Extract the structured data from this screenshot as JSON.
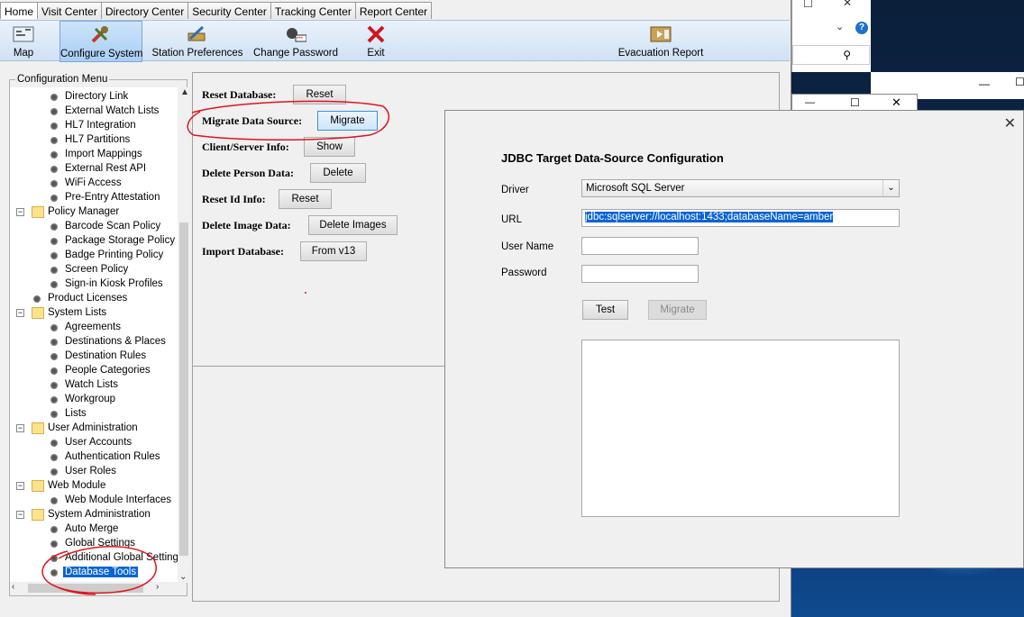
{
  "tabs": [
    "Home",
    "Visit Center",
    "Directory Center",
    "Security Center",
    "Tracking Center",
    "Report Center"
  ],
  "toolbar": {
    "map": "Map",
    "configure": "Configure System",
    "station": "Station Preferences",
    "password": "Change Password",
    "exit": "Exit",
    "evacuation": "Evacuation Report"
  },
  "config_menu": {
    "title": "Configuration Menu",
    "items": [
      {
        "label": "Directory Link",
        "level": 2
      },
      {
        "label": "External Watch Lists",
        "level": 2
      },
      {
        "label": "HL7 Integration",
        "level": 2
      },
      {
        "label": "HL7 Partitions",
        "level": 2
      },
      {
        "label": "Import Mappings",
        "level": 2
      },
      {
        "label": "External Rest API",
        "level": 2
      },
      {
        "label": "WiFi Access",
        "level": 2
      },
      {
        "label": "Pre-Entry Attestation",
        "level": 2
      },
      {
        "label": "Policy Manager",
        "level": 1
      },
      {
        "label": "Barcode Scan Policy",
        "level": 2
      },
      {
        "label": "Package Storage Policy",
        "level": 2
      },
      {
        "label": "Badge Printing Policy",
        "level": 2
      },
      {
        "label": "Screen Policy",
        "level": 2
      },
      {
        "label": "Sign-in Kiosk Profiles",
        "level": 2
      },
      {
        "label": "Product Licenses",
        "level": 1
      },
      {
        "label": "System Lists",
        "level": 1
      },
      {
        "label": "Agreements",
        "level": 2
      },
      {
        "label": "Destinations & Places",
        "level": 2
      },
      {
        "label": "Destination Rules",
        "level": 2
      },
      {
        "label": "People Categories",
        "level": 2
      },
      {
        "label": "Watch Lists",
        "level": 2
      },
      {
        "label": "Workgroup",
        "level": 2
      },
      {
        "label": "Lists",
        "level": 2
      },
      {
        "label": "User Administration",
        "level": 1
      },
      {
        "label": "User Accounts",
        "level": 2
      },
      {
        "label": "Authentication Rules",
        "level": 2
      },
      {
        "label": "User Roles",
        "level": 2
      },
      {
        "label": "Web Module",
        "level": 1
      },
      {
        "label": "Web Module Interfaces",
        "level": 2
      },
      {
        "label": "System Administration",
        "level": 1
      },
      {
        "label": "Auto Merge",
        "level": 2
      },
      {
        "label": "Global Settings",
        "level": 2
      },
      {
        "label": "Additional Global Settings",
        "level": 2
      },
      {
        "label": "Database Tools",
        "level": 2,
        "selected": true
      }
    ]
  },
  "db_tools": {
    "reset_db_label": "Reset Database:",
    "reset_db_btn": "Reset",
    "migrate_label": "Migrate Data Source:",
    "migrate_btn": "Migrate",
    "client_label": "Client/Server Info:",
    "client_btn": "Show",
    "delete_person_label": "Delete Person Data:",
    "delete_person_btn": "Delete",
    "reset_id_label": "Reset Id Info:",
    "reset_id_btn": "Reset",
    "delete_image_label": "Delete Image Data:",
    "delete_image_btn": "Delete Images",
    "import_label": "Import Database:",
    "import_btn": "From v13"
  },
  "dialog": {
    "title": "JDBC Target Data-Source Configuration",
    "driver_label": "Driver",
    "driver_value": "Microsoft SQL Server",
    "url_label": "URL",
    "url_value": "jdbc:sqlserver://localhost:1433;databaseName=amber",
    "user_label": "User Name",
    "user_value": "",
    "password_label": "Password",
    "password_value": "",
    "test_btn": "Test",
    "migrate_btn": "Migrate"
  },
  "accent_color": "#0a64d6",
  "annotation_color": "#e0141e"
}
